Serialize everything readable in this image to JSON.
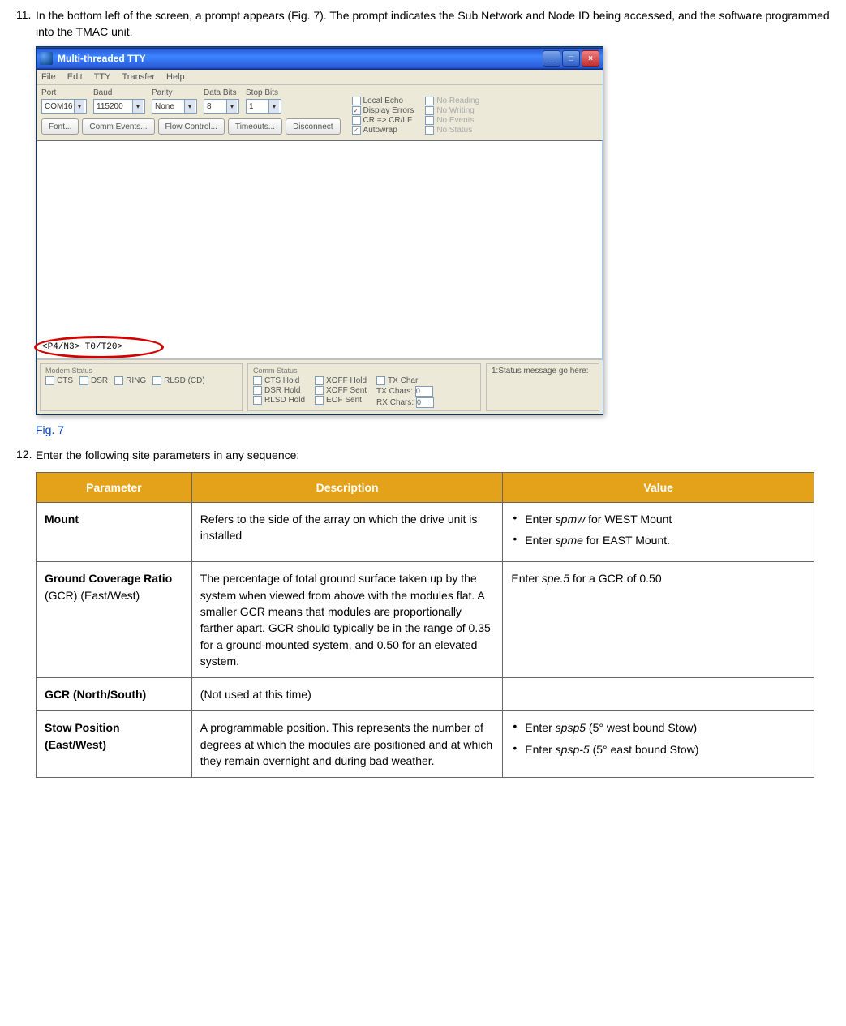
{
  "steps": {
    "s11": {
      "num": "11.",
      "text": "In the bottom left of the screen, a prompt appears (Fig. 7). The prompt indicates the Sub Network and Node ID being accessed, and the software programmed into the TMAC unit."
    },
    "s12": {
      "num": "12.",
      "text": "Enter the following site parameters in any sequence:"
    }
  },
  "figure": {
    "caption": "Fig. 7",
    "window": {
      "title": "Multi-threaded TTY",
      "menu": [
        "File",
        "Edit",
        "TTY",
        "Transfer",
        "Help"
      ],
      "toolbar": {
        "port": {
          "label": "Port",
          "value": "COM16"
        },
        "baud": {
          "label": "Baud",
          "value": "115200"
        },
        "parity": {
          "label": "Parity",
          "value": "None"
        },
        "databits": {
          "label": "Data Bits",
          "value": "8"
        },
        "stopbits": {
          "label": "Stop Bits",
          "value": "1"
        },
        "buttons": [
          "Font...",
          "Comm Events...",
          "Flow Control...",
          "Timeouts...",
          "Disconnect"
        ],
        "checks_left": [
          {
            "label": "Local Echo",
            "checked": false
          },
          {
            "label": "Display Errors",
            "checked": true
          },
          {
            "label": "CR => CR/LF",
            "checked": false
          },
          {
            "label": "Autowrap",
            "checked": true
          }
        ],
        "checks_right": [
          {
            "label": "No Reading"
          },
          {
            "label": "No Writing"
          },
          {
            "label": "No Events"
          },
          {
            "label": "No Status"
          }
        ]
      },
      "prompt": "<P4/N3> T0/T20>",
      "status": {
        "modem_header": "Modem Status",
        "modem_items": [
          "CTS",
          "DSR",
          "RING",
          "RLSD (CD)"
        ],
        "comm_header": "Comm Status",
        "comm_col1": [
          "CTS Hold",
          "DSR Hold",
          "RLSD Hold"
        ],
        "comm_col2": [
          "XOFF Hold",
          "XOFF Sent",
          "EOF Sent"
        ],
        "comm_col3_labels": [
          "TX Char",
          "TX Chars:",
          "RX Chars:"
        ],
        "comm_col3_vals": [
          "",
          "0",
          "0"
        ],
        "msg_header": "1:Status message go here:"
      }
    }
  },
  "table": {
    "headers": [
      "Parameter",
      "Description",
      "Value"
    ],
    "rows": [
      {
        "param": "Mount",
        "desc": "Refers to the side of the array on which the drive unit is installed",
        "value_items": [
          {
            "pre": "Enter ",
            "cmd": "spmw",
            "post": " for WEST Mount"
          },
          {
            "pre": "Enter ",
            "cmd": "spme",
            "post": " for EAST Mount."
          }
        ]
      },
      {
        "param_html": "Ground Coverage Ratio",
        "param_tail": " (GCR) (East/West)",
        "desc": "The percentage of total ground surface taken up by the system when viewed from above with the modules flat. A smaller GCR means that modules are proportionally farther apart. GCR should typically be in the range of 0.35 for a ground-mounted system, and 0.50 for an elevated system.",
        "value_plain": {
          "pre": "Enter ",
          "cmd": "spe.5",
          "post": " for a GCR of 0.50"
        }
      },
      {
        "param": "GCR (North/South)",
        "desc": "(Not used at this time)",
        "value_empty": ""
      },
      {
        "param": "Stow Position (East/West)",
        "desc": "A programmable position. This represents the number of degrees at which the modules are positioned and at which they remain overnight and during bad weather.",
        "value_items": [
          {
            "pre": "Enter ",
            "cmd": "spsp5",
            "post": " (5° west bound Stow)"
          },
          {
            "pre": "Enter ",
            "cmd": "spsp-5",
            "post": " (5° east bound Stow)"
          }
        ]
      }
    ]
  }
}
